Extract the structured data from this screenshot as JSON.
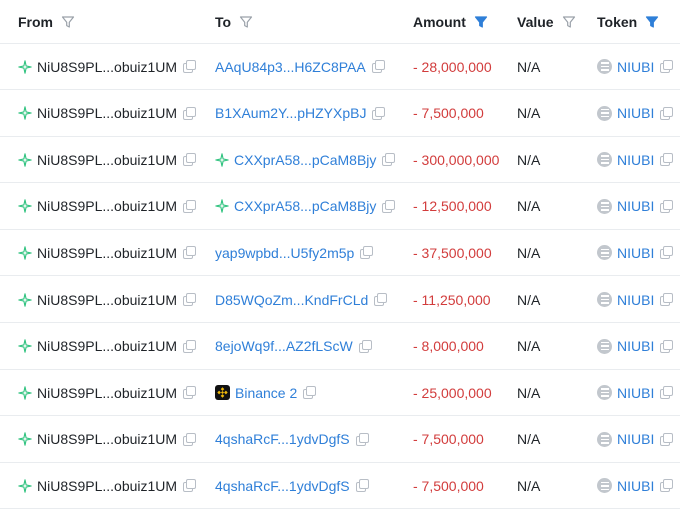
{
  "header": {
    "from": "From",
    "to": "To",
    "amount": "Amount",
    "value": "Value",
    "token": "Token"
  },
  "colors": {
    "link": "#2f7fd8",
    "negative": "#d23c3c",
    "filter_active": "#2f7fd8",
    "filter_inactive": "#9aa1a9",
    "wallet_icon": "#2ec27e"
  },
  "rows": [
    {
      "from": "NiU8S9PL...obuiz1UM",
      "to": "AAqU84p3...H6ZC8PAA",
      "to_icon": "",
      "amount": "- 28,000,000",
      "value": "N/A",
      "token": "NIUBI"
    },
    {
      "from": "NiU8S9PL...obuiz1UM",
      "to": "B1XAum2Y...pHZYXpBJ",
      "to_icon": "",
      "amount": "- 7,500,000",
      "value": "N/A",
      "token": "NIUBI"
    },
    {
      "from": "NiU8S9PL...obuiz1UM",
      "to": "CXXprA58...pCaM8Bjy",
      "to_icon": "sparkle-icon",
      "amount": "- 300,000,000",
      "value": "N/A",
      "token": "NIUBI"
    },
    {
      "from": "NiU8S9PL...obuiz1UM",
      "to": "CXXprA58...pCaM8Bjy",
      "to_icon": "sparkle-icon",
      "amount": "- 12,500,000",
      "value": "N/A",
      "token": "NIUBI"
    },
    {
      "from": "NiU8S9PL...obuiz1UM",
      "to": "yap9wpbd...U5fy2m5p",
      "to_icon": "",
      "amount": "- 37,500,000",
      "value": "N/A",
      "token": "NIUBI"
    },
    {
      "from": "NiU8S9PL...obuiz1UM",
      "to": "D85WQoZm...KndFrCLd",
      "to_icon": "",
      "amount": "- 11,250,000",
      "value": "N/A",
      "token": "NIUBI"
    },
    {
      "from": "NiU8S9PL...obuiz1UM",
      "to": "8ejoWq9f...AZ2fLScW",
      "to_icon": "",
      "amount": "- 8,000,000",
      "value": "N/A",
      "token": "NIUBI"
    },
    {
      "from": "NiU8S9PL...obuiz1UM",
      "to": "Binance 2",
      "to_icon": "binance-icon",
      "amount": "- 25,000,000",
      "value": "N/A",
      "token": "NIUBI"
    },
    {
      "from": "NiU8S9PL...obuiz1UM",
      "to": "4qshaRcF...1ydvDgfS",
      "to_icon": "",
      "amount": "- 7,500,000",
      "value": "N/A",
      "token": "NIUBI"
    },
    {
      "from": "NiU8S9PL...obuiz1UM",
      "to": "4qshaRcF...1ydvDgfS",
      "to_icon": "",
      "amount": "- 7,500,000",
      "value": "N/A",
      "token": "NIUBI"
    }
  ]
}
